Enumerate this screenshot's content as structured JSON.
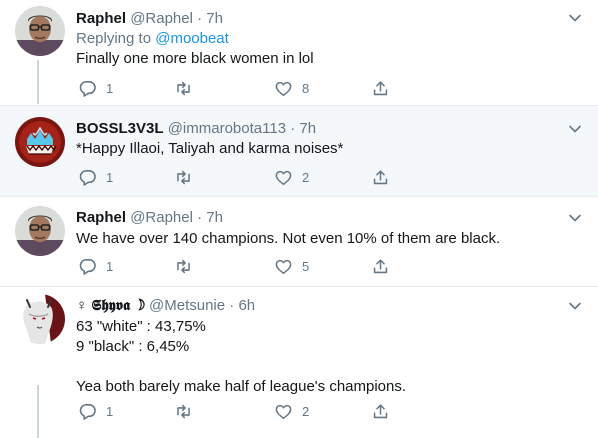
{
  "tweets": [
    {
      "name": "Raphel",
      "handle": "@Raphel",
      "time": "7h",
      "replying_label": "Replying to",
      "replying_handle": "@moobeat",
      "text": "Finally one more black women in lol",
      "replies": "1",
      "retweets": "",
      "likes": "8"
    },
    {
      "name": "BOSSL3V3L",
      "handle": "@immarobota113",
      "time": "7h",
      "text": "*Happy Illaoi, Taliyah and karma noises*",
      "replies": "1",
      "retweets": "",
      "likes": "2"
    },
    {
      "name": "Raphel",
      "handle": "@Raphel",
      "time": "7h",
      "text": "We have over 140 champions. Not even 10% of them are black.",
      "replies": "1",
      "retweets": "",
      "likes": "5"
    },
    {
      "name": "♀ 𝕾𝖍𝖞𝖛𝖆 ☽",
      "handle": "@Metsunie",
      "time": "6h",
      "text": "63 \"white\" : 43,75%\n9 \"black\" : 6,45%\n\nYea both barely make half of league's champions.",
      "replies": "1",
      "retweets": "",
      "likes": "2"
    }
  ],
  "separator": "·",
  "icons": [
    "reply-icon",
    "retweet-icon",
    "like-icon",
    "share-icon",
    "chevron-down-icon"
  ],
  "colors": {
    "link": "#1b95e0",
    "muted": "#657786",
    "highlight_bg": "#f5f8fa",
    "border": "#e6ecf0"
  }
}
